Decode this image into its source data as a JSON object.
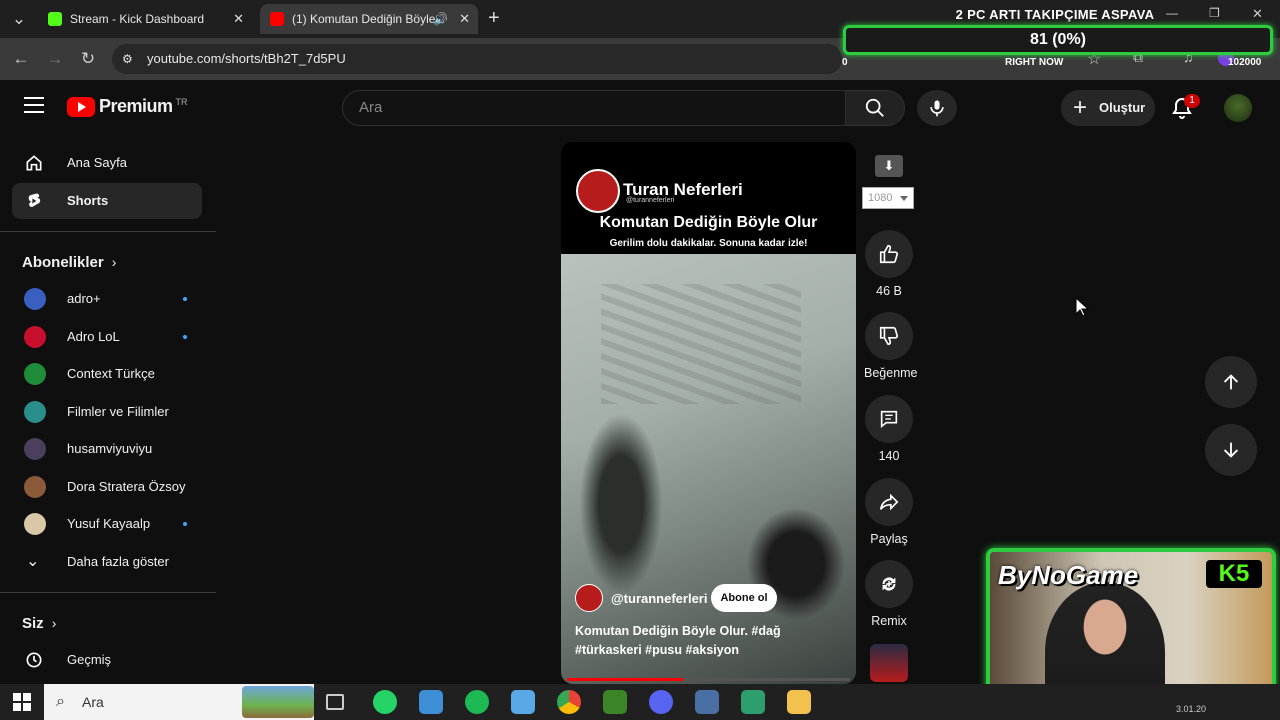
{
  "browser": {
    "tabs": [
      {
        "title": "Stream - Kick Dashboard",
        "favicon_color": "#53fc18"
      },
      {
        "title": "(1) Komutan Dediğin Böyle",
        "favicon_color": "#ff0000"
      }
    ],
    "url": "youtube.com/shorts/tBh2T_7d5PU"
  },
  "stream_overlay": {
    "title": "2 PC ARTI TAKIPÇIME ASPAVA",
    "goal_value": "81 (0%)",
    "goal_min": "0",
    "goal_label": "RIGHT NOW",
    "goal_max": "102000",
    "accent_color": "#2ecc40"
  },
  "youtube": {
    "logo_text": "Premium",
    "logo_region": "TR",
    "search_placeholder": "Ara",
    "create_label": "Oluştur",
    "notification_count": "1",
    "sidebar": {
      "main_items": [
        {
          "label": "Ana Sayfa",
          "icon": "home-icon"
        },
        {
          "label": "Shorts",
          "icon": "shorts-icon",
          "active": true
        }
      ],
      "subscriptions_title": "Abonelikler",
      "subscriptions": [
        {
          "label": "adro+",
          "color": "#3b5fc0",
          "new": true
        },
        {
          "label": "Adro LoL",
          "color": "#c8102e",
          "new": true
        },
        {
          "label": "Context Türkçe",
          "color": "#1f8c3b",
          "new": false
        },
        {
          "label": "Filmler ve Filimler",
          "color": "#2a8f8a",
          "new": false
        },
        {
          "label": "husamviyuviyu",
          "color": "#4a3f5c",
          "new": false
        },
        {
          "label": "Dora Stratera Özsoy",
          "color": "#8a5a3a",
          "new": false
        },
        {
          "label": "Yusuf Kayaalp",
          "color": "#d9c7a8",
          "new": true
        }
      ],
      "show_more_label": "Daha fazla göster",
      "you_title": "Siz",
      "history_label": "Geçmiş"
    },
    "short": {
      "channel_overlay_name": "Turan Neferleri",
      "channel_overlay_handle": "@turanneferleri",
      "overlay_title": "Komutan Dediğin Böyle Olur",
      "overlay_subtitle": "Gerilim dolu dakikalar. Sonuna kadar izle!",
      "handle": "@turanneferleri",
      "subscribe_label": "Abone ol",
      "description": "Komutan Dediğin Böyle Olur. #dağ #türkaskeri #pusu #aksiyon",
      "progress_fraction": 0.41,
      "quality": "1080"
    },
    "actions": {
      "like_count": "46 B",
      "dislike_label": "Beğenme",
      "comment_count": "140",
      "share_label": "Paylaş",
      "remix_label": "Remix"
    }
  },
  "webcam": {
    "streamer_name": "ByNoGame",
    "badge": "K5"
  },
  "taskbar": {
    "search_placeholder": "Ara",
    "clock": "3.01.20"
  }
}
